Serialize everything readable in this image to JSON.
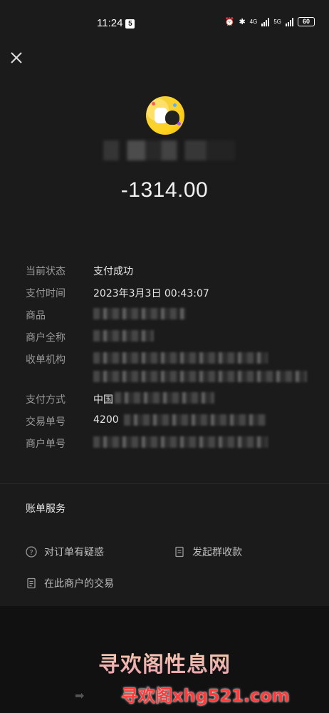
{
  "status_bar": {
    "time": "11:24",
    "time_badge": "5",
    "battery": "60",
    "net1": "4G",
    "net2": "5G"
  },
  "header": {
    "close_icon": "close-icon"
  },
  "payment": {
    "amount": "-1314.00"
  },
  "details": {
    "status_label": "当前状态",
    "status_value": "支付成功",
    "time_label": "支付时间",
    "time_value": "2023年3月3日 00:43:07",
    "goods_label": "商品",
    "merchant_full_label": "商户全称",
    "acquirer_label": "收单机构",
    "pay_method_label": "支付方式",
    "pay_method_value": "中国",
    "txn_no_label": "交易单号",
    "txn_no_value": "4200",
    "merchant_no_label": "商户单号"
  },
  "services": {
    "title": "账单服务",
    "doubt": "对订单有疑惑",
    "group_collect": "发起群收款",
    "merchant_txn": "在此商户的交易"
  },
  "watermark": {
    "line1": "寻欢阁性息网",
    "line2": "寻欢阁xhg521.com"
  },
  "colors": {
    "background": "#1b1b1b",
    "label": "#9a9a9a",
    "value": "#e6e6e6"
  }
}
